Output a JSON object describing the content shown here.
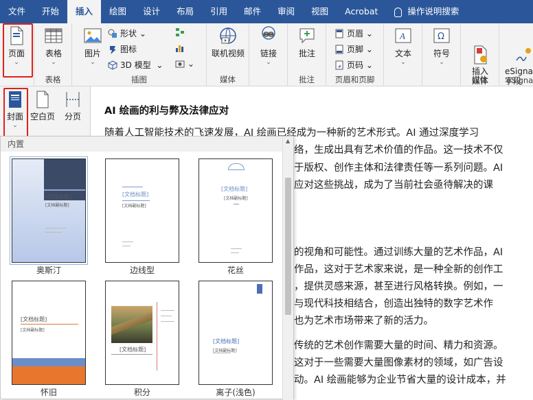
{
  "menu": {
    "items": [
      "文件",
      "开始",
      "插入",
      "绘图",
      "设计",
      "布局",
      "引用",
      "邮件",
      "审阅",
      "视图",
      "Acrobat"
    ],
    "active": "插入",
    "search_label": "操作说明搜索"
  },
  "ribbon": {
    "pages_label": "页面",
    "table_label": "表格",
    "table_group": "表格",
    "picture_label": "图片",
    "shapes_label": "形状",
    "icons_label": "图标",
    "model3d_label": "3D 模型",
    "illustrations_group": "插图",
    "online_video_label": "联机视频",
    "media_group": "媒体",
    "link_label": "链接",
    "comment_label": "批注",
    "comment_group": "批注",
    "header_label": "页眉",
    "footer_label": "页脚",
    "page_number_label": "页码",
    "header_footer_group": "页眉和页脚",
    "text_label": "文本",
    "symbol_label": "符号",
    "insert_media_label": "插入\n媒体",
    "media2_group": "媒体",
    "esign_label": "eSigna\n字段",
    "esign_group": "eSigna"
  },
  "subribbon": {
    "cover_label": "封面",
    "blank_label": "空白页",
    "break_label": "分页"
  },
  "gallery": {
    "header": "内置",
    "items": [
      {
        "name": "奥斯汀",
        "title": "[文档标题]",
        "subtitle": "[文档副标题]"
      },
      {
        "name": "边线型",
        "title": "[文档标题]",
        "subtitle": "[文档副标题]"
      },
      {
        "name": "花丝",
        "title": "[文档标题]",
        "subtitle": "[文档副标题]"
      },
      {
        "name": "怀旧",
        "title": "[文档标题]",
        "subtitle": "[文档副标题]"
      },
      {
        "name": "积分",
        "title": "[文档标题]",
        "subtitle": ""
      },
      {
        "name": "离子(浅色)",
        "title": "[文档标题]",
        "subtitle": "[文档副标题]"
      }
    ]
  },
  "document": {
    "title": "AI 绘画的利与弊及法律应对",
    "p1_lines": [
      "随着人工智能技术的飞速发展，AI 绘画已经成为一种新的艺术形式。AI 通过深度学习",
      "络，生成出具有艺术价值的作品。这一技术不仅",
      "于版权、创作主体和法律责任等一系列问题。AI",
      "应对这些挑战，成为了当前社会亟待解决的课"
    ],
    "p2_lines": [
      "的视角和可能性。通过训练大量的艺术作品，AI",
      "作品，这对于艺术家来说，是一种全新的创作工",
      "，提供灵感来源，甚至进行风格转换。例如，一",
      "与现代科技相结合，创造出独特的数字艺术作",
      "也为艺术市场带来了新的活力。"
    ],
    "p3_lines": [
      "传统的艺术创作需要大量的时间、精力和资源。",
      "这对于一些需要大量图像素材的领域，如广告设",
      "动。AI 绘画能够为企业节省大量的设计成本，并"
    ]
  }
}
